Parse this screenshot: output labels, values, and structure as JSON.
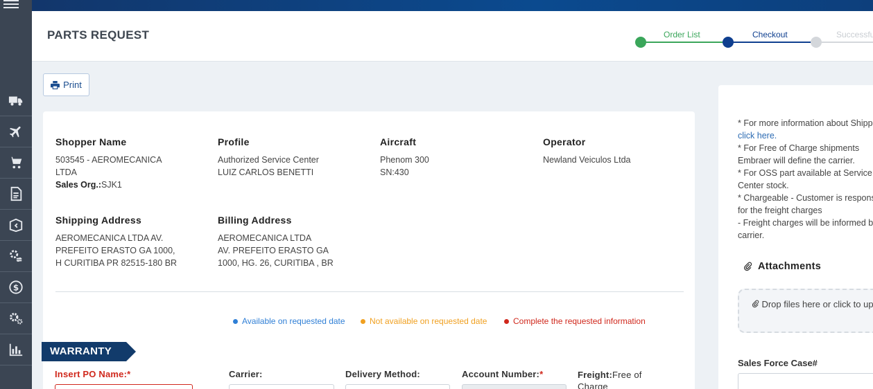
{
  "header": {
    "title": "PARTS REQUEST",
    "steps": [
      {
        "label": "Order List",
        "state": "done"
      },
      {
        "label": "Checkout",
        "state": "active"
      },
      {
        "label": "Successful",
        "state": "pending"
      }
    ]
  },
  "colors": {
    "done": "#3aa65a",
    "active": "#0f3f8f",
    "pending": "#d4d7db",
    "available": "#2f7fd6",
    "not_available": "#f0a020",
    "complete_info": "#d0281c"
  },
  "sidebar": {
    "items": [
      {
        "icon": "truck-icon"
      },
      {
        "icon": "airplane-icon"
      },
      {
        "icon": "cart-icon"
      },
      {
        "icon": "document-icon"
      },
      {
        "icon": "box-return-icon"
      },
      {
        "icon": "gears-exchange-icon"
      },
      {
        "icon": "money-icon"
      },
      {
        "icon": "settings-icon"
      },
      {
        "icon": "chart-icon"
      }
    ]
  },
  "toolbar": {
    "print_label": "Print"
  },
  "order": {
    "shopper_label": "Shopper Name",
    "shopper_line1": "503545 - AEROMECANICA",
    "shopper_line2": "LTDA",
    "sales_org_label": "Sales Org.:",
    "sales_org_value": "SJK1",
    "profile_label": "Profile",
    "profile_line1": "Authorized Service Center",
    "profile_line2": "LUIZ CARLOS BENETTI",
    "aircraft_label": "Aircraft",
    "aircraft_model": "Phenom 300",
    "aircraft_sn": "SN:430",
    "operator_label": "Operator",
    "operator_value": "Newland Veiculos Ltda",
    "shipping_label": "Shipping Address",
    "shipping_line1": "AEROMECANICA LTDA AV.",
    "shipping_line2": "PREFEITO ERASTO GA 1000,",
    "shipping_line3": "H CURITIBA PR 82515-180 BR",
    "billing_label": "Billing Address",
    "billing_line1": "AEROMECANICA LTDA",
    "billing_line2": "AV. PREFEITO ERASTO GA",
    "billing_line3": "1000, HG. 26, CURITIBA , BR"
  },
  "legend": {
    "available": "Available on requested date",
    "not_available": "Not available on requested date",
    "complete_info": "Complete the requested information"
  },
  "warranty": {
    "tag": "WARRANTY",
    "po_label": "Insert PO Name:",
    "carrier_label": "Carrier:",
    "delivery_label": "Delivery Method:",
    "account_label": "Account Number:",
    "freight_label": "Freight:",
    "freight_value": "Free of",
    "freight_value2": "Charge",
    "required_mark": "*"
  },
  "side": {
    "ship_info_1": "* For more information about Shipping, ",
    "ship_link": "click here.",
    "ship_info_2": "* For Free of Charge shipments Embraer will define the carrier.\n* For OSS part available at Service Center stock.\n* Chargeable - Customer is responsible for the freight charges\n- Freight charges will be informed by carrier.",
    "attachments_label": "Attachments",
    "dropzone_text": "Drop files here or click to upload",
    "salesforce_label": "Sales Force Case#"
  }
}
